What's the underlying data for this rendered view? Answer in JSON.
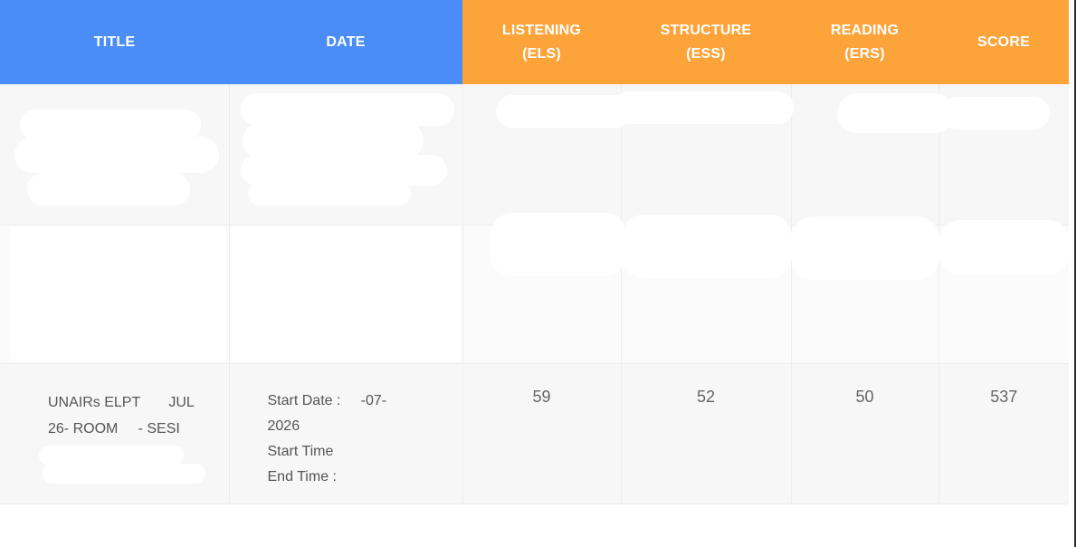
{
  "table": {
    "headers": {
      "title": "TITLE",
      "date": "DATE",
      "listening": [
        "LISTENING",
        "(ELS)"
      ],
      "structure": [
        "STRUCTURE",
        "(ESS)"
      ],
      "reading": [
        "READING",
        "(ERS)"
      ],
      "score": "SCORE"
    },
    "rows": [
      {
        "title_line1": "UNAIRs ELPT",
        "title_month": "JUL",
        "title_line2a": "26- ROOM",
        "title_line2b": "- SESI",
        "date_start_label": "Start Date :",
        "date_start_month": "-07-",
        "date_year": "2026",
        "start_time_label": "Start Time",
        "end_time_label": "End Time :",
        "listening": "59",
        "structure": "52",
        "reading": "50",
        "score": "537"
      }
    ]
  },
  "colors": {
    "header_blue": "#4a8df8",
    "header_orange": "#fca43a"
  }
}
